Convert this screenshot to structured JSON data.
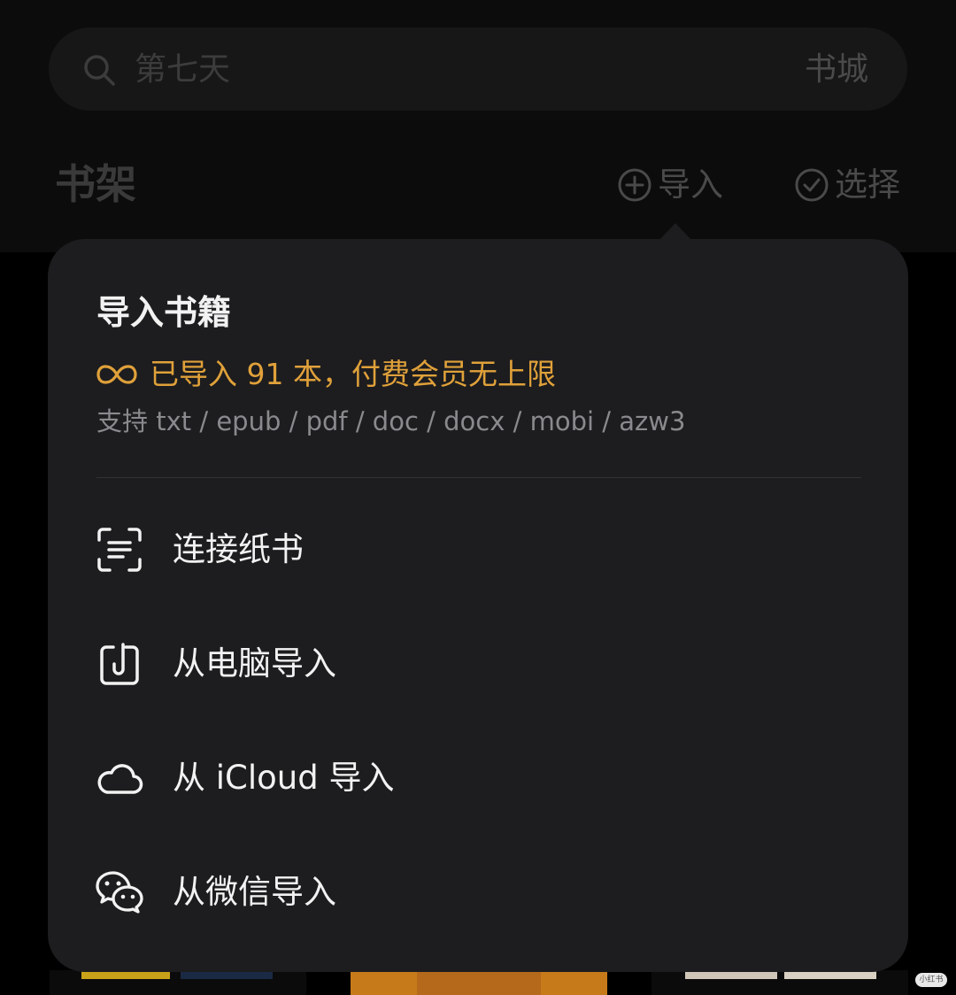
{
  "search": {
    "placeholder": "第七天",
    "store_label": "书城"
  },
  "header": {
    "title": "书架",
    "import_label": "导入",
    "select_label": "选择"
  },
  "popover": {
    "title": "导入书籍",
    "quota_text": "已导入 91 本，付费会员无上限",
    "formats_text": "支持 txt / epub / pdf / doc / docx / mobi / azw3",
    "items": [
      {
        "label": "连接纸书",
        "icon": "scan-icon"
      },
      {
        "label": "从电脑导入",
        "icon": "device-import-icon"
      },
      {
        "label": "从 iCloud 导入",
        "icon": "cloud-icon"
      },
      {
        "label": "从微信导入",
        "icon": "wechat-icon"
      }
    ]
  },
  "colors": {
    "accent": "#e0a13a",
    "popover_bg": "#1d1d1f",
    "text_primary": "#f2f2f2",
    "text_secondary": "#8a8a8e"
  },
  "watermark": "小红书"
}
